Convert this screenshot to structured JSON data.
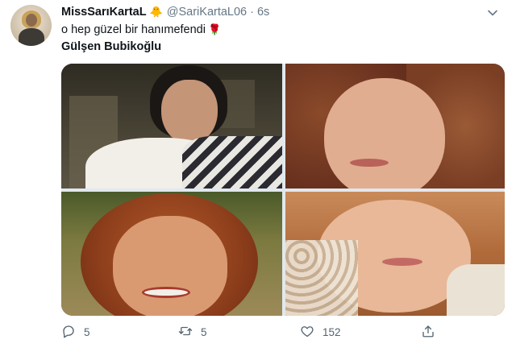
{
  "tweet": {
    "display_name": "MissSarıKartaL",
    "name_emoji": "🐥",
    "handle": "@SariKartaL06",
    "separator": "·",
    "time": "6s",
    "text_line1": "o hep güzel bir hanımefendi",
    "text_emoji": "🌹",
    "text_line2": "Gülşen Bubikoğlu"
  },
  "actions": {
    "reply_count": "5",
    "retweet_count": "5",
    "like_count": "152"
  },
  "icons": {
    "menu": "chevron-down-icon",
    "reply": "reply-icon",
    "retweet": "retweet-icon",
    "like": "heart-icon",
    "share": "share-icon"
  },
  "colors": {
    "text_primary": "#0f1419",
    "text_secondary": "#657786",
    "action_gray": "#536471"
  }
}
